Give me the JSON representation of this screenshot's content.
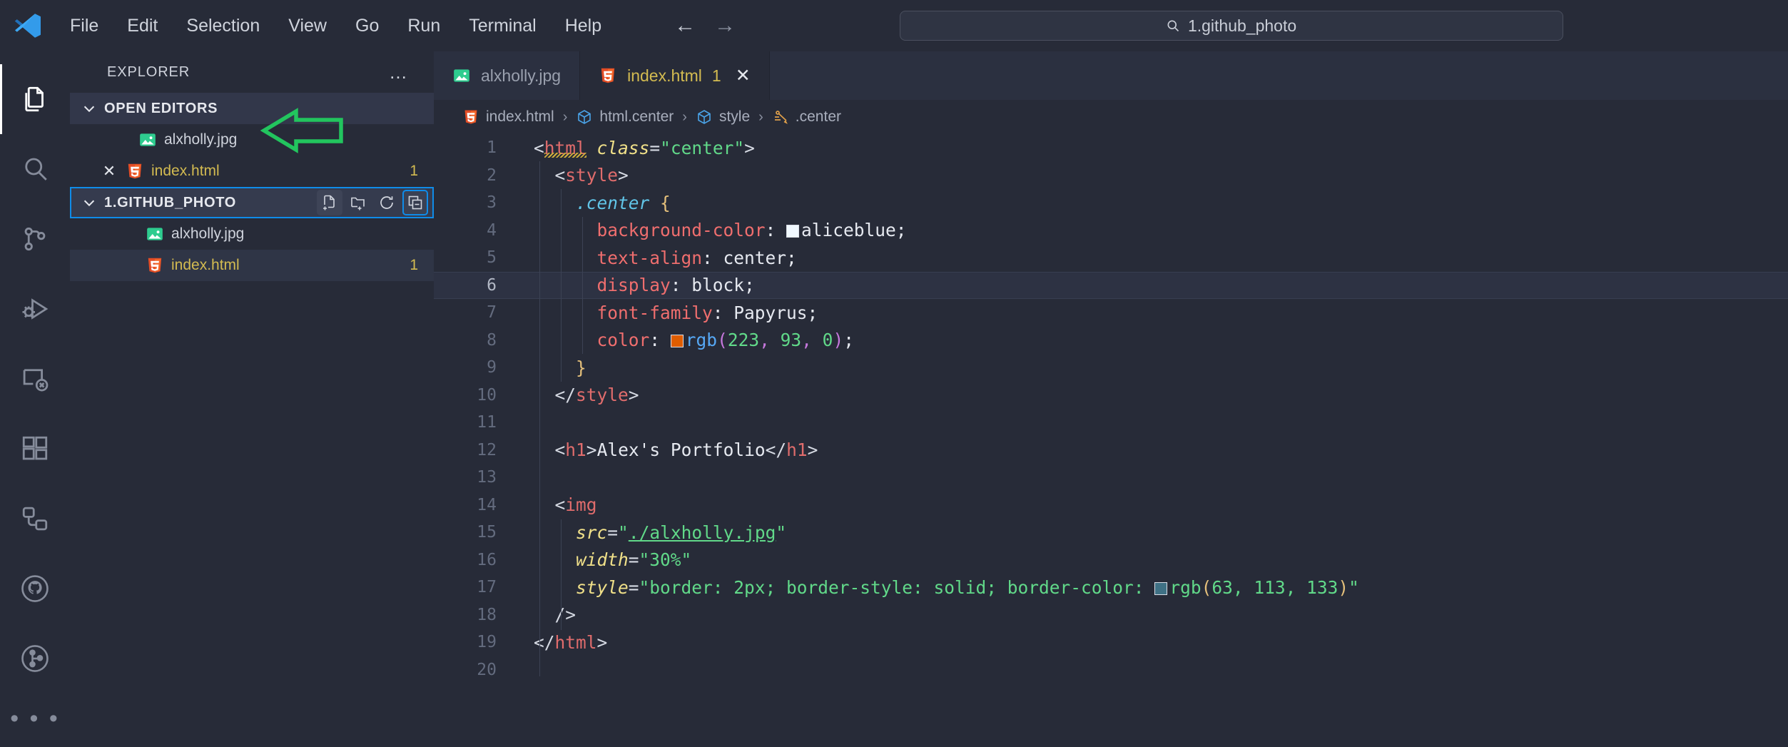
{
  "window": {
    "app": "Visual Studio Code",
    "logo_name": "vscode-logo"
  },
  "menubar": {
    "items": [
      "File",
      "Edit",
      "Selection",
      "View",
      "Go",
      "Run",
      "Terminal",
      "Help"
    ]
  },
  "navigation": {
    "back_glyph": "←",
    "forward_glyph": "→"
  },
  "search": {
    "icon": "search-icon",
    "value": "1.github_photo"
  },
  "activitybar": {
    "items": [
      {
        "name": "explorer",
        "label": "Explorer",
        "active": true
      },
      {
        "name": "search",
        "label": "Search",
        "active": false
      },
      {
        "name": "source-control",
        "label": "Source Control",
        "active": false
      },
      {
        "name": "run-and-debug",
        "label": "Run and Debug",
        "active": false
      },
      {
        "name": "remote-explorer",
        "label": "Remote Explorer",
        "active": false
      },
      {
        "name": "extensions",
        "label": "Extensions",
        "active": false
      },
      {
        "name": "dependency-graph",
        "label": "Dependency Graph",
        "active": false
      },
      {
        "name": "github",
        "label": "GitHub",
        "active": false
      },
      {
        "name": "git-graph",
        "label": "Git Graph",
        "active": false
      }
    ],
    "more_glyph": "• • •"
  },
  "sidebar": {
    "title": "EXPLORER",
    "more_actions_glyph": "…",
    "open_editors": {
      "label": "OPEN EDITORS",
      "expanded": true,
      "items": [
        {
          "name": "alxholly.jpg",
          "icon": "image-file-icon",
          "badge": "",
          "modified": false,
          "has_close": false
        },
        {
          "name": "index.html",
          "icon": "html5-file-icon",
          "badge": "1",
          "modified": true,
          "has_close": true
        }
      ]
    },
    "folder": {
      "label": "1.GITHUB_PHOTO",
      "expanded": true,
      "focused": true,
      "actions": [
        {
          "name": "new-file-icon",
          "title": "New File"
        },
        {
          "name": "new-folder-icon",
          "title": "New Folder"
        },
        {
          "name": "refresh-icon",
          "title": "Refresh Explorer"
        },
        {
          "name": "collapse-all-icon",
          "title": "Collapse Folders in Explorer"
        }
      ],
      "items": [
        {
          "name": "alxholly.jpg",
          "icon": "image-file-icon",
          "badge": "",
          "modified": false
        },
        {
          "name": "index.html",
          "icon": "html5-file-icon",
          "badge": "1",
          "modified": true
        }
      ]
    }
  },
  "editor": {
    "tabs": [
      {
        "label": "alxholly.jpg",
        "icon": "image-file-icon",
        "active": false,
        "badge": "",
        "closable": false
      },
      {
        "label": "index.html",
        "icon": "html5-file-icon",
        "active": true,
        "badge": "1",
        "closable": true,
        "close_glyph": "✕"
      }
    ],
    "breadcrumbs": [
      {
        "label": "index.html",
        "icon": "html5-file-icon"
      },
      {
        "label": "html.center",
        "icon": "symbol-cube-icon"
      },
      {
        "label": "style",
        "icon": "symbol-cube-icon"
      },
      {
        "label": ".center",
        "icon": "symbol-css-rule-icon"
      }
    ],
    "breadcrumb_separator": "›",
    "current_line": 6,
    "total_lines": 20,
    "lines": [
      {
        "n": 1,
        "text": "<html class=\"center\">"
      },
      {
        "n": 2,
        "text": "  <style>"
      },
      {
        "n": 3,
        "text": "    .center {"
      },
      {
        "n": 4,
        "text": "      background-color: aliceblue;"
      },
      {
        "n": 5,
        "text": "      text-align: center;"
      },
      {
        "n": 6,
        "text": "      display: block;"
      },
      {
        "n": 7,
        "text": "      font-family: Papyrus;"
      },
      {
        "n": 8,
        "text": "      color: rgb(223, 93, 0);"
      },
      {
        "n": 9,
        "text": "    }"
      },
      {
        "n": 10,
        "text": "  </style>"
      },
      {
        "n": 11,
        "text": ""
      },
      {
        "n": 12,
        "text": "  <h1>Alex's Portfolio</h1>"
      },
      {
        "n": 13,
        "text": ""
      },
      {
        "n": 14,
        "text": "  <img"
      },
      {
        "n": 15,
        "text": "    src=\"./alxholly.jpg\""
      },
      {
        "n": 16,
        "text": "    width=\"30%\""
      },
      {
        "n": 17,
        "text": "    style=\"border: 2px; border-style: solid; border-color: rgb(63, 113, 133)\""
      },
      {
        "n": 18,
        "text": "  />"
      },
      {
        "n": 19,
        "text": "</html>"
      },
      {
        "n": 20,
        "text": ""
      }
    ],
    "color_swatches": {
      "aliceblue": "#f0f8ff",
      "rgb_223_93_0": "#df5d00",
      "rgb_63_113_133": "#3f7185"
    }
  },
  "annotation": {
    "name": "green-arrow-callout",
    "color": "#22c55e",
    "points_at": "explorer-folder-action-icons"
  },
  "colors": {
    "background": "#272b38",
    "sidebar_section": "#32374a",
    "focus_blue": "#0f8ce9",
    "modified_yellow": "#d3bb51",
    "annotation_green": "#22c55e"
  }
}
